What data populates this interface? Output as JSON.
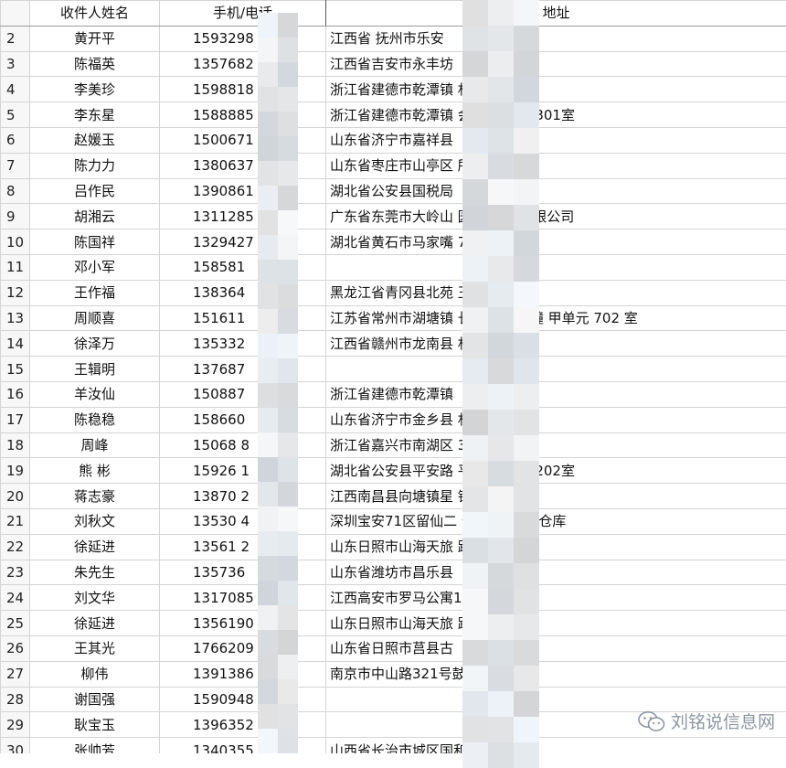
{
  "headers": {
    "name": "收件人姓名",
    "phone": "手机/电话",
    "address": "地址"
  },
  "rows": [
    {
      "num": "2",
      "name": "黄开平",
      "phone": "1593298",
      "address": "江西省 抚州市乐安"
    },
    {
      "num": "3",
      "name": "陈福英",
      "phone": "1357682",
      "address": "江西省吉安市永丰坊"
    },
    {
      "num": "4",
      "name": "李美珍",
      "phone": "1598818",
      "address": "浙江省建德市乾潭镇              村"
    },
    {
      "num": "5",
      "name": "李东星",
      "phone": "1588885",
      "address": " 浙江省建德市乾潭镇          会汇商厦1幢301室"
    },
    {
      "num": "6",
      "name": "赵媛玉",
      "phone": "1500671",
      "address": "山东省济宁市嘉祥县"
    },
    {
      "num": "7",
      "name": "陈力力",
      "phone": "1380637",
      "address": "山东省枣庄市山亭区              所"
    },
    {
      "num": "8",
      "name": "吕作民",
      "phone": "1390861",
      "address": "湖北省公安县国税局"
    },
    {
      "num": "9",
      "name": "胡湘云",
      "phone": "1311285",
      "address": "广东省东莞市大岭山          园3M中国有限公司"
    },
    {
      "num": "10",
      "name": "陈国祥",
      "phone": "1329427",
      "address": "湖北省黄石市马家嘴            7号"
    },
    {
      "num": "11",
      "name": "邓小军",
      "phone": "158581",
      "address": ""
    },
    {
      "num": "12",
      "name": "王作福",
      "phone": "138364",
      "address": "黑龙江省青冈县北苑          玉鑫源超市"
    },
    {
      "num": "13",
      "name": "周顺喜",
      "phone": "151611",
      "address": "江苏省常州市湖塘镇        长河花园 5 幢 甲单元 702 室"
    },
    {
      "num": "14",
      "name": "徐泽万",
      "phone": "135332",
      "address": "江西省赣州市龙南县            村126号"
    },
    {
      "num": "15",
      "name": "王辑明",
      "phone": "137687",
      "address": ""
    },
    {
      "num": "16",
      "name": "羊汝仙",
      "phone": "150887",
      "address": "浙江省建德市乾潭镇"
    },
    {
      "num": "17",
      "name": "陈稳稳",
      "phone": "158660",
      "address": "山东省济宁市金乡县            村"
    },
    {
      "num": "18",
      "name": "周峰",
      "phone": "15068        8",
      "address": "浙江省嘉兴市南湖区            307室"
    },
    {
      "num": "19",
      "name": "熊 彬",
      "phone": "15926        1",
      "address": "湖北省公安县平安路        平安公寓1栋202室"
    },
    {
      "num": "20",
      "name": "蒋志豪",
      "phone": "13870        2",
      "address": "江西南昌县向塘镇星            镇政府"
    },
    {
      "num": "21",
      "name": "刘秋文",
      "phone": "13530        4",
      "address": "深圳宝安71区留仙二          仓库3楼移动仓库"
    },
    {
      "num": "22",
      "name": "徐延进",
      "phone": "13561        2",
      "address": "山东日照市山海天旅            路阳光佳园"
    },
    {
      "num": "23",
      "name": "朱先生",
      "phone": "135736",
      "address": "山东省潍坊市昌乐县"
    },
    {
      "num": "24",
      "name": "刘文华",
      "phone": "1317085",
      "address": "江西高安市罗马公寓1          刘文华老师"
    },
    {
      "num": "25",
      "name": "徐延进",
      "phone": "1356190",
      "address": "山东日照市山海天旅            路阳光佳园"
    },
    {
      "num": "26",
      "name": "王其光",
      "phone": "1766209",
      "address": "山东省日照市莒县古"
    },
    {
      "num": "27",
      "name": "柳伟",
      "phone": "1391386",
      "address": "南京市中山路321号鼓"
    },
    {
      "num": "28",
      "name": "谢国强",
      "phone": "1590948",
      "address": ""
    },
    {
      "num": "29",
      "name": "耿宝玉",
      "phone": "1396352",
      "address": ""
    },
    {
      "num": "30",
      "name": "张帅芳",
      "phone": "1340355",
      "address": "山西省长治市城区国和"
    }
  ],
  "watermark": {
    "text": "刘铭说信息网",
    "icon": "wechat-icon"
  },
  "colors": {
    "grid": "#d4d4d4",
    "header_border": "#9a9a9a",
    "row_number_bg": "#f7f7f7",
    "watermark": "#7a8590"
  }
}
